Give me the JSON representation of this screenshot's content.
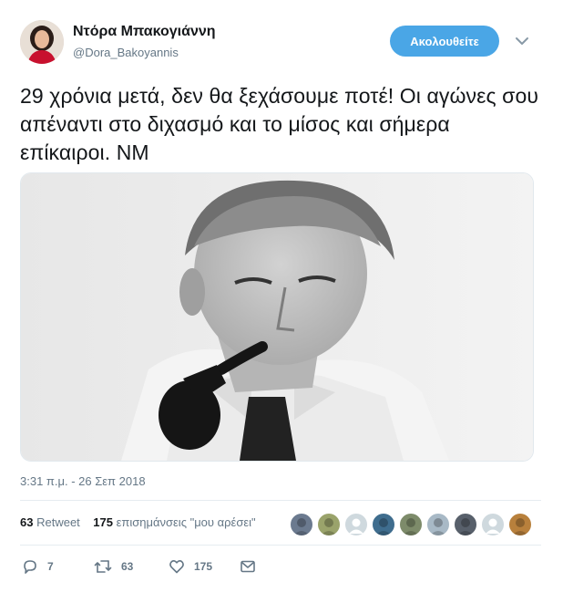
{
  "author": {
    "name": "Ντόρα Μπακογιάννη",
    "handle": "@Dora_Bakoyannis"
  },
  "follow_button": {
    "label": "Ακολουθείτε"
  },
  "tweet": {
    "text": "29 χρόνια μετά, δεν θα ξεχάσουμε ποτέ! Οι αγώνες σου απέναντι στο διχασμό και το μίσος και σήμερα επίκαιροι. ΝΜ",
    "timestamp": "3:31 π.μ. - 26 Σεπ 2018"
  },
  "stats": {
    "retweets_count": "63",
    "retweets_label": "Retweet",
    "likes_count": "175",
    "likes_label": "επισημάνσεις \"μου αρέσει\""
  },
  "likers": [
    {
      "color": "#6b7a8f",
      "icon": "avatar-photo"
    },
    {
      "color": "#9aa36b",
      "icon": "avatar-photo"
    },
    {
      "color": "#cfd9de",
      "icon": "avatar-default"
    },
    {
      "color": "#3f6d8e",
      "icon": "avatar-photo"
    },
    {
      "color": "#7d8b6a",
      "icon": "avatar-photo"
    },
    {
      "color": "#a8b9c6",
      "icon": "avatar-photo"
    },
    {
      "color": "#58606b",
      "icon": "avatar-photo"
    },
    {
      "color": "#cfd9de",
      "icon": "avatar-default"
    },
    {
      "color": "#b8803c",
      "icon": "avatar-photo"
    }
  ],
  "actions": {
    "reply_count": "7",
    "retweet_count": "63",
    "like_count": "175"
  },
  "colors": {
    "accent": "#4aa6e6",
    "secondary_text": "#657786",
    "divider": "#e6ecf0"
  }
}
